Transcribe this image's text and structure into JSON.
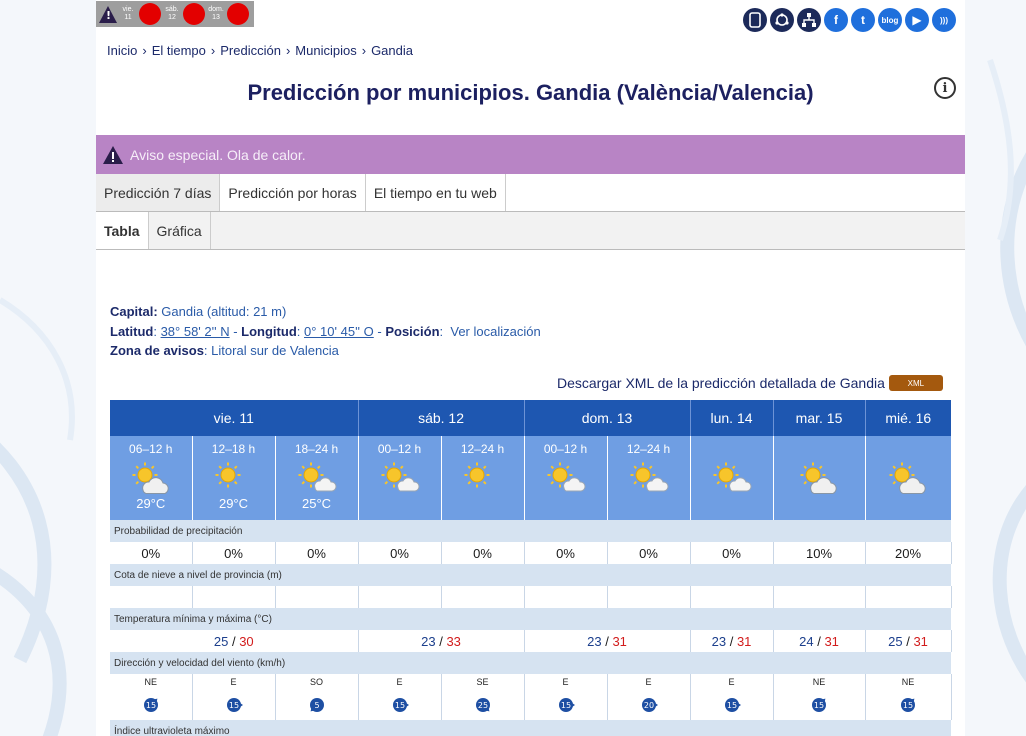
{
  "alert_strip": {
    "days": [
      {
        "label_day": "vie.",
        "label_num": "11"
      },
      {
        "label_day": "sáb.",
        "label_num": "12"
      },
      {
        "label_day": "dom.",
        "label_num": "13"
      }
    ]
  },
  "social_icons": [
    "mobile-icon",
    "network-icon",
    "sitemap-icon",
    "facebook-icon",
    "twitter-icon",
    "blog-icon",
    "youtube-icon",
    "rss-icon"
  ],
  "social_glyphs": {
    "facebook": "f",
    "twitter": "t",
    "blog": "blog",
    "youtube": "▶",
    "rss": ")))"
  },
  "breadcrumb": [
    "Inicio",
    "El tiempo",
    "Predicción",
    "Municipios",
    "Gandia"
  ],
  "breadcrumb_sep": "›",
  "page_title": "Predicción por municipios. Gandia (València/Valencia)",
  "info_glyph": "i",
  "special_warning": "Aviso especial. Ola de calor.",
  "tabs": [
    "Predicción 7 días",
    "Predicción por horas",
    "El tiempo en tu web"
  ],
  "subtabs": [
    "Tabla",
    "Gráfica"
  ],
  "location": {
    "capital_label": "Capital:",
    "capital_value": "Gandia (altitud: 21 m)",
    "lat_label": "Latitud",
    "lat_value": "38° 58' 2'' N",
    "lon_label": "Longitud",
    "lon_value": "0° 10' 45'' O",
    "pos_label": "Posición",
    "pos_value": "Ver localización",
    "zone_label": "Zona de avisos",
    "zone_value": "Litoral sur de Valencia",
    "sep_colon": ":",
    "sep_dash": " - "
  },
  "xml": {
    "text": "Descargar XML de la predicción detallada de Gandia",
    "badge": "XML"
  },
  "days": [
    {
      "label": "vie. 11",
      "span": 3
    },
    {
      "label": "sáb. 12",
      "span": 2
    },
    {
      "label": "dom. 13",
      "span": 2
    },
    {
      "label": "lun. 14",
      "span": 1
    },
    {
      "label": "mar. 15",
      "span": 1
    },
    {
      "label": "mié. 16",
      "span": 1
    }
  ],
  "periods": [
    {
      "time": "06–12 h",
      "sky": "partly-cloudy-icon",
      "temp": "29°C"
    },
    {
      "time": "12–18 h",
      "sky": "sunny-icon",
      "temp": "29°C"
    },
    {
      "time": "18–24 h",
      "sky": "sun-cloud-icon",
      "temp": "25°C"
    },
    {
      "time": "00–12 h",
      "sky": "sun-cloud-icon",
      "temp": ""
    },
    {
      "time": "12–24 h",
      "sky": "sunny-icon",
      "temp": ""
    },
    {
      "time": "00–12 h",
      "sky": "sun-cloud-icon",
      "temp": ""
    },
    {
      "time": "12–24 h",
      "sky": "sun-cloud-icon",
      "temp": ""
    },
    {
      "time": "",
      "sky": "sun-cloud-icon",
      "temp": ""
    },
    {
      "time": "",
      "sky": "partly-cloudy-icon",
      "temp": ""
    },
    {
      "time": "",
      "sky": "partly-cloudy-icon",
      "temp": ""
    }
  ],
  "precip_label": "Probabilidad de precipitación",
  "precip": [
    "0%",
    "0%",
    "0%",
    "0%",
    "0%",
    "0%",
    "0%",
    "0%",
    "10%",
    "20%"
  ],
  "snow_label": "Cota de nieve a nivel de provincia (m)",
  "snow": [
    "",
    "",
    "",
    "",
    "",
    "",
    "",
    "",
    "",
    ""
  ],
  "temp_label": "Temperatura mínima y máxima (°C)",
  "temp_sep": " / ",
  "temps": [
    {
      "min": "25",
      "max": "30"
    },
    {
      "min": "23",
      "max": "33"
    },
    {
      "min": "23",
      "max": "31"
    },
    {
      "min": "23",
      "max": "31"
    },
    {
      "min": "24",
      "max": "31"
    },
    {
      "min": "25",
      "max": "31"
    }
  ],
  "wind_label": "Dirección y velocidad del viento (km/h)",
  "wind": [
    {
      "dir": "NE",
      "speed": "15"
    },
    {
      "dir": "E",
      "speed": "15"
    },
    {
      "dir": "SO",
      "speed": "5"
    },
    {
      "dir": "E",
      "speed": "15"
    },
    {
      "dir": "SE",
      "speed": "25"
    },
    {
      "dir": "E",
      "speed": "15"
    },
    {
      "dir": "E",
      "speed": "20"
    },
    {
      "dir": "E",
      "speed": "15"
    },
    {
      "dir": "NE",
      "speed": "15"
    },
    {
      "dir": "NE",
      "speed": "15"
    }
  ],
  "uv_label": "Índice ultravioleta máximo",
  "colors": {
    "header_blue": "#1e57b1",
    "period_blue": "#6f9ee3",
    "warning_purple": "#b884c5",
    "alert_red": "#e30000",
    "max_red": "#d21c1c"
  }
}
